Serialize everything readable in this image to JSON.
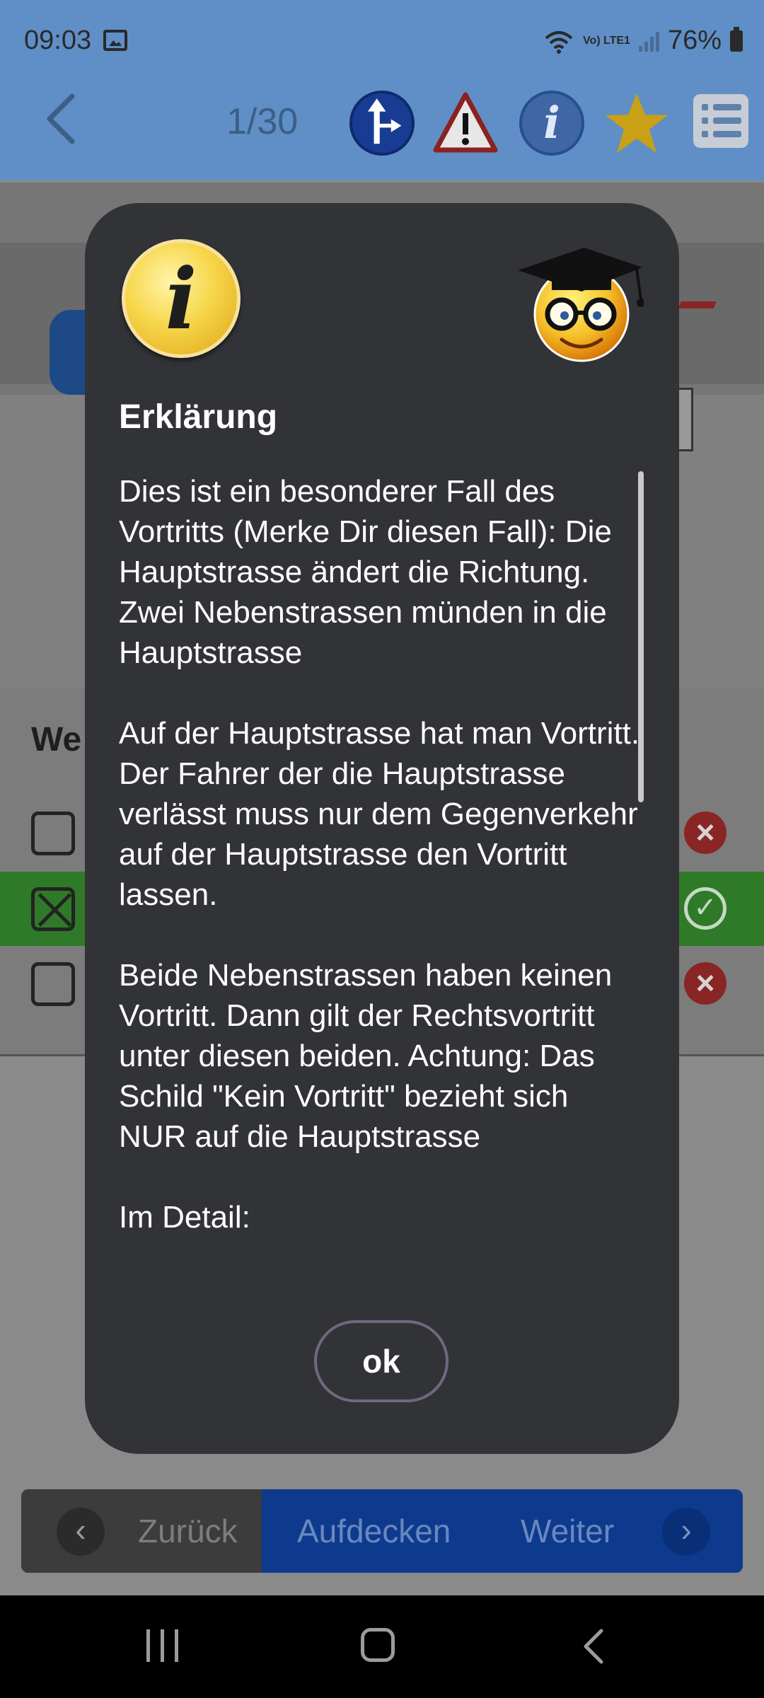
{
  "status_bar": {
    "time": "09:03",
    "network": "Vo) LTE1",
    "battery": "76%"
  },
  "toolbar": {
    "counter": "1/30"
  },
  "question": {
    "label_partial": "We"
  },
  "dialog": {
    "title": "Erklärung",
    "body": "Dies ist ein besonderer Fall des Vortritts (Merke Dir diesen Fall): Die Hauptstrasse ändert die Richtung. Zwei Nebenstrassen münden in die Hauptstrasse\n\nAuf der Hauptstrasse hat man Vortritt. Der Fahrer der die Hauptstrasse verlässt muss nur dem Gegenverkehr auf der Hauptstrasse den Vortritt lassen.\n\nBeide Nebenstrassen haben keinen Vortritt. Dann gilt der Rechtsvortritt unter diesen beiden. Achtung: Das Schild \"Kein Vortritt\" bezieht sich NUR auf die Hauptstrasse\n\nIm Detail:",
    "ok_label": "ok"
  },
  "bottom_nav": {
    "back_label": "Zurück",
    "reveal_label": "Aufdecken",
    "next_label": "Weiter"
  },
  "colors": {
    "header": "#5f8fc6",
    "dialog_bg": "#323337",
    "correct_row": "#2e7a28",
    "nav_bar": "#0e3a8e"
  },
  "icons": [
    "back-arrow-icon",
    "direction-sign-icon",
    "warning-icon",
    "info-icon",
    "star-icon",
    "list-icon",
    "graduate-smiley-icon",
    "wrong-icon",
    "check-icon"
  ]
}
